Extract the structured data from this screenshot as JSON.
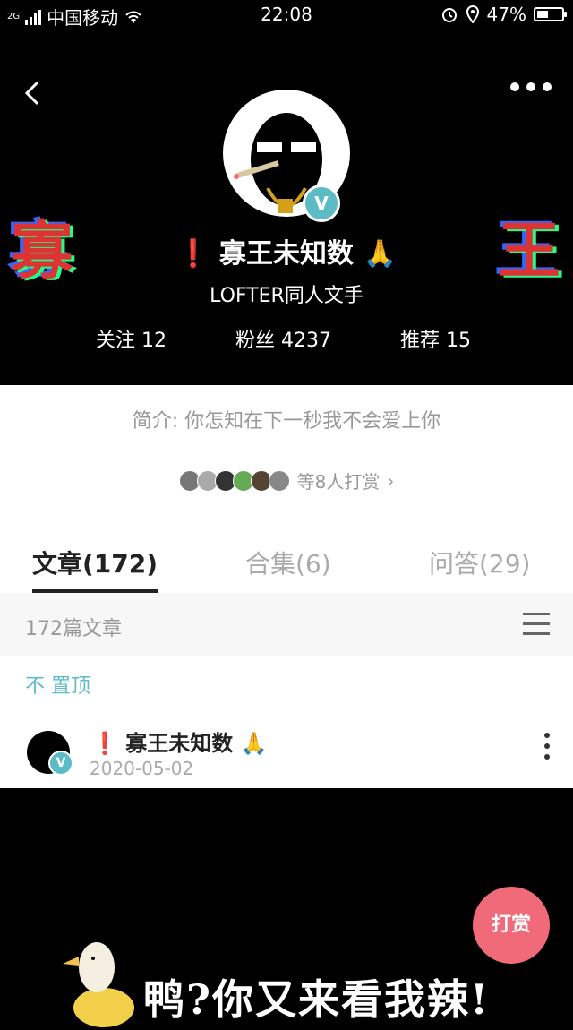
{
  "status_bar": {
    "network": "2G",
    "carrier": "中国移动",
    "time": "22:08",
    "battery": "47%",
    "battery_level": 0.47
  },
  "profile": {
    "name": "寡王未知数",
    "subtitle": "LOFTER同人文手",
    "verified": "V",
    "stats": [
      {
        "label": "关注",
        "value": "12"
      },
      {
        "label": "粉丝",
        "value": "4237"
      },
      {
        "label": "推荐",
        "value": "15"
      }
    ],
    "glitch_left": "寡",
    "glitch_right": "王"
  },
  "intro": "简介: 你怎知在下一秒我不会爱上你",
  "rewards": {
    "text": "等8人打赏",
    "chevron": "›"
  },
  "tabs": [
    {
      "label": "文章(172)",
      "active": true
    },
    {
      "label": "合集(6)",
      "active": false
    },
    {
      "label": "问答(29)",
      "active": false
    }
  ],
  "list_header": {
    "count_text": "172篇文章"
  },
  "pinned_label": "不 置顶",
  "post": {
    "title": "寡王未知数",
    "date": "2020-05-02",
    "badge": "V"
  },
  "footer": {
    "banner_text": "鸭?你又来看我辣!"
  },
  "tip_button": "打赏",
  "icons": {
    "back": "back-icon",
    "more": "more-icon",
    "wifi": "wifi-icon",
    "alarm": "alarm-icon",
    "location": "location-icon",
    "menu": "menu-icon",
    "kebab": "kebab-icon"
  },
  "colors": {
    "accent": "#5bbcc6",
    "tip": "#f06a7a",
    "warning": "#e53"
  }
}
